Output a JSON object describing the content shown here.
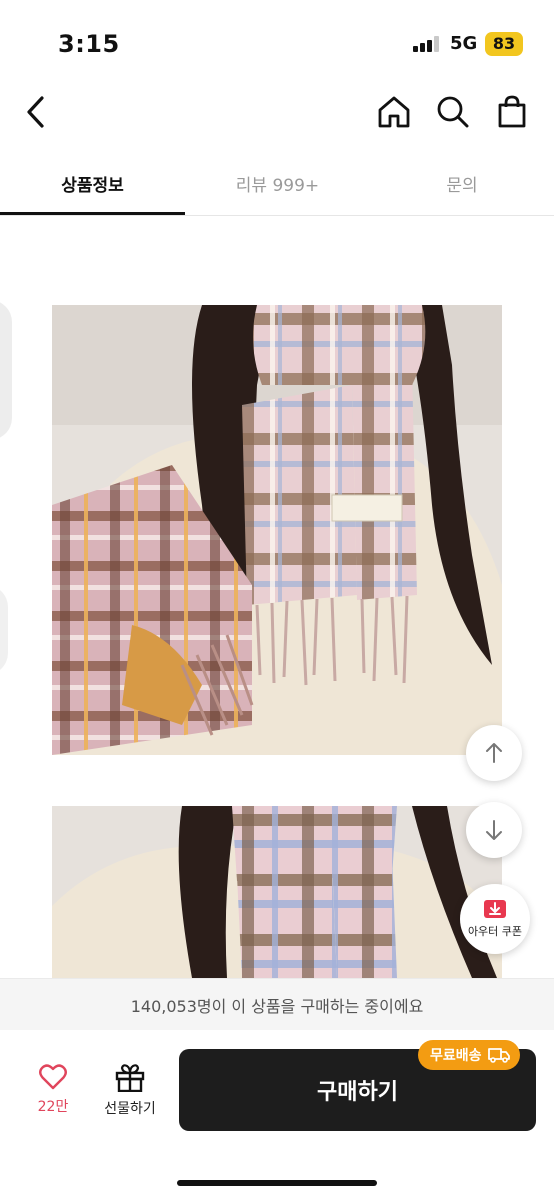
{
  "status_bar": {
    "time": "3:15",
    "network": "5G",
    "battery": "83"
  },
  "nav": {
    "back_icon": "chevron-left-icon",
    "home_icon": "home-icon",
    "search_icon": "search-icon",
    "cart_icon": "shopping-bag-icon"
  },
  "tabs": [
    {
      "label": "상품정보",
      "active": true
    },
    {
      "label": "리뷰 999+",
      "active": false
    },
    {
      "label": "문의",
      "active": false
    }
  ],
  "floating": {
    "scroll_up_icon": "arrow-up-icon",
    "scroll_down_icon": "arrow-down-icon",
    "coupon_label": "아우터 쿠폰"
  },
  "notice": {
    "text": "140,053명이 이 상품을 구매하는 중이에요"
  },
  "actions": {
    "like_count": "22만",
    "gift_label": "선물하기",
    "buy_label": "구매하기",
    "shipping_badge": "무료배송"
  },
  "colors": {
    "accent_like": "#e0455c",
    "buy_button": "#1d1d1d",
    "shipping_badge": "#f39c12",
    "battery": "#f2c61f"
  }
}
